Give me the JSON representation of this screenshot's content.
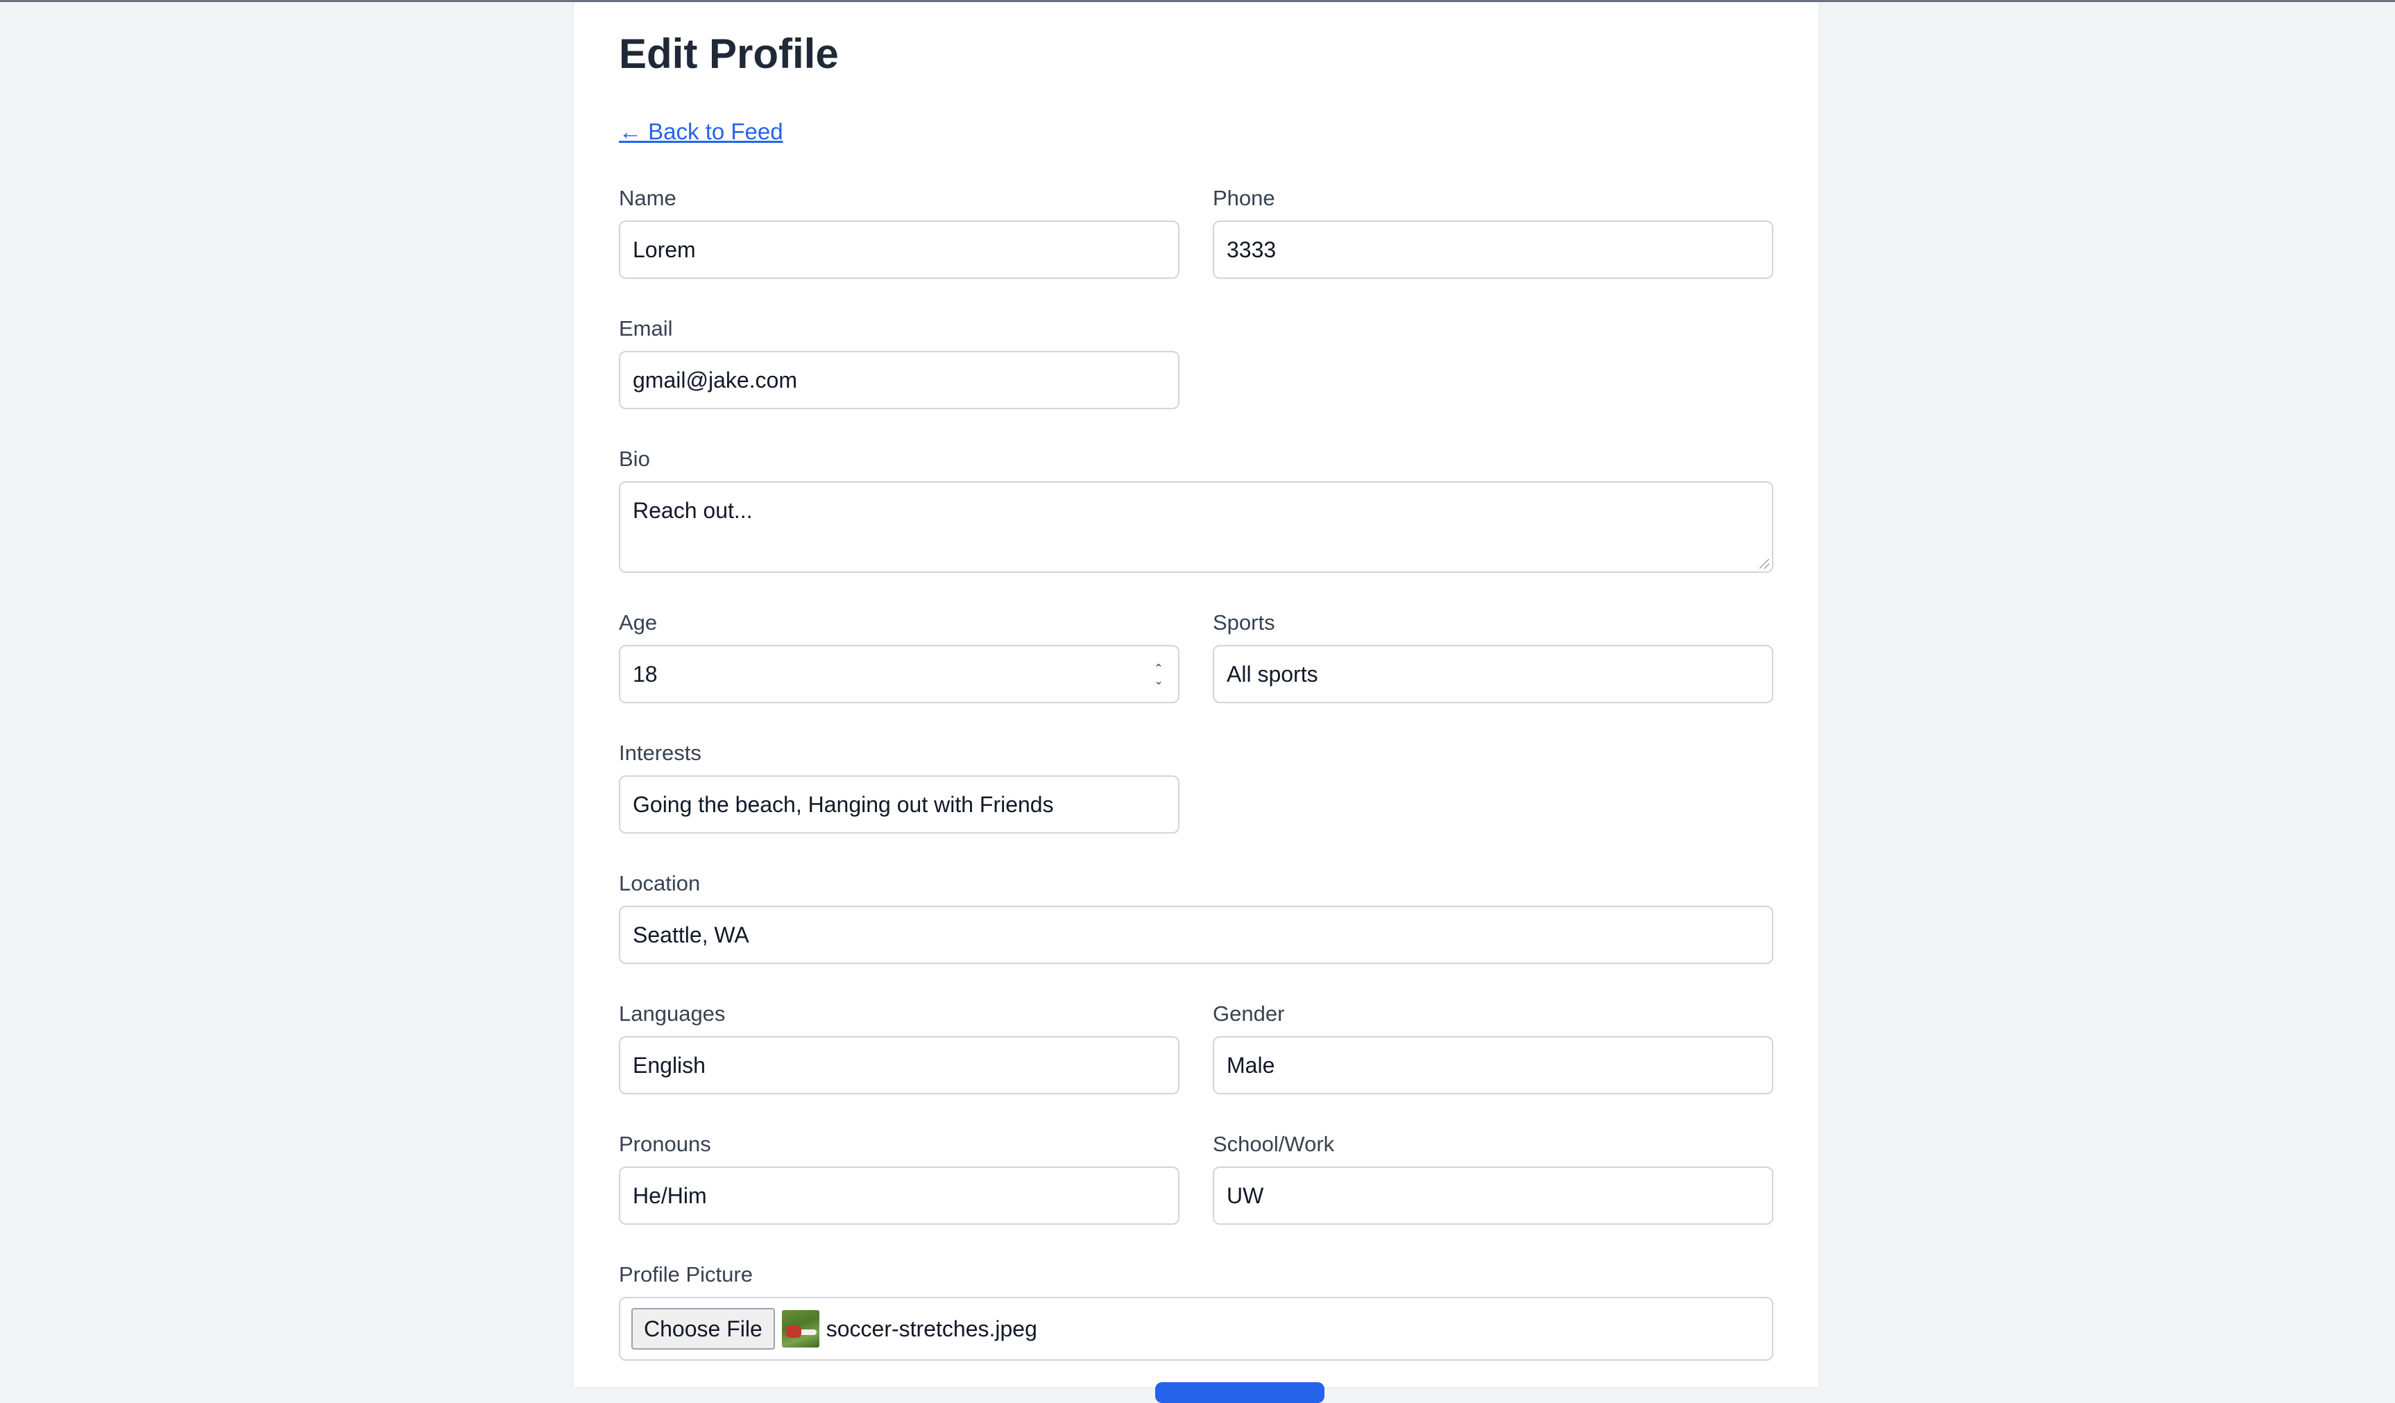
{
  "page": {
    "title": "Edit Profile",
    "back_link": "← Back to Feed"
  },
  "form": {
    "name": {
      "label": "Name",
      "value": "Lorem"
    },
    "phone": {
      "label": "Phone",
      "value": "3333"
    },
    "email": {
      "label": "Email",
      "value": "gmail@jake.com"
    },
    "bio": {
      "label": "Bio",
      "value": "Reach out..."
    },
    "age": {
      "label": "Age",
      "value": "18"
    },
    "sports": {
      "label": "Sports",
      "value": "All sports"
    },
    "interests": {
      "label": "Interests",
      "value": "Going the beach, Hanging out with Friends"
    },
    "location": {
      "label": "Location",
      "value": "Seattle, WA"
    },
    "languages": {
      "label": "Languages",
      "value": "English"
    },
    "gender": {
      "label": "Gender",
      "value": "Male"
    },
    "pronouns": {
      "label": "Pronouns",
      "value": "He/Him"
    },
    "school_work": {
      "label": "School/Work",
      "value": "UW"
    },
    "profile_picture": {
      "label": "Profile Picture",
      "button_label": "Choose File",
      "file_name": "soccer-stretches.jpeg"
    }
  },
  "colors": {
    "accent": "#2563eb",
    "page_bg": "#f3f4f6",
    "card_bg": "#ffffff",
    "heading": "#1f2937"
  },
  "icons": {
    "spinner": "up-down-spinner-icon",
    "resize": "resize-grip-icon"
  }
}
